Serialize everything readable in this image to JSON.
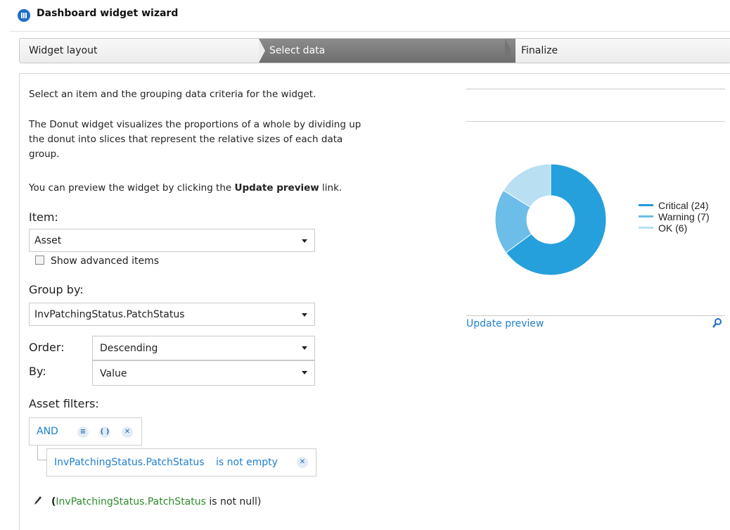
{
  "window": {
    "title": "Dashboard widget wizard"
  },
  "steps": [
    {
      "label": "Widget layout",
      "active": false
    },
    {
      "label": "Select data",
      "active": true
    },
    {
      "label": "Finalize",
      "active": false
    }
  ],
  "intro": {
    "line1": "Select an item and the grouping data criteria for the widget.",
    "desc_l1": "The Donut widget visualizes the proportions of a whole by dividing up",
    "desc_l2": "the donut into slices that represent the relative sizes of each data",
    "desc_l3": "group.",
    "preview_pre": "You can preview the widget by clicking the ",
    "preview_bold": "Update preview",
    "preview_post": " link."
  },
  "item": {
    "label": "Item:",
    "value": "Asset",
    "advanced_label": "Show advanced items",
    "advanced_checked": false
  },
  "group_by": {
    "label": "Group by:",
    "value": "InvPatchingStatus.PatchStatus"
  },
  "order": {
    "label": "Order:",
    "value": "Descending"
  },
  "by": {
    "label": "By:",
    "value": "Value"
  },
  "filters": {
    "label": "Asset filters:",
    "operator": "AND",
    "condition_field": "InvPatchingStatus.PatchStatus",
    "condition_op": "is not empty",
    "summary_open": "(",
    "summary_field": "InvPatchingStatus.PatchStatus",
    "summary_rest": " is not null)"
  },
  "preview": {
    "update_link": "Update preview",
    "legend": [
      {
        "label": "Critical (24)",
        "color": "#1f9ad9"
      },
      {
        "label": "Warning (7)",
        "color": "#6cbde8"
      },
      {
        "label": "OK (6)",
        "color": "#b8dff2"
      }
    ]
  },
  "chart_data": {
    "type": "pie",
    "donut": true,
    "categories": [
      "Critical",
      "Warning",
      "OK"
    ],
    "values": [
      24,
      7,
      6
    ],
    "colors": [
      "#26a0dc",
      "#6cbde8",
      "#b8dff2"
    ],
    "legend_position": "right"
  }
}
